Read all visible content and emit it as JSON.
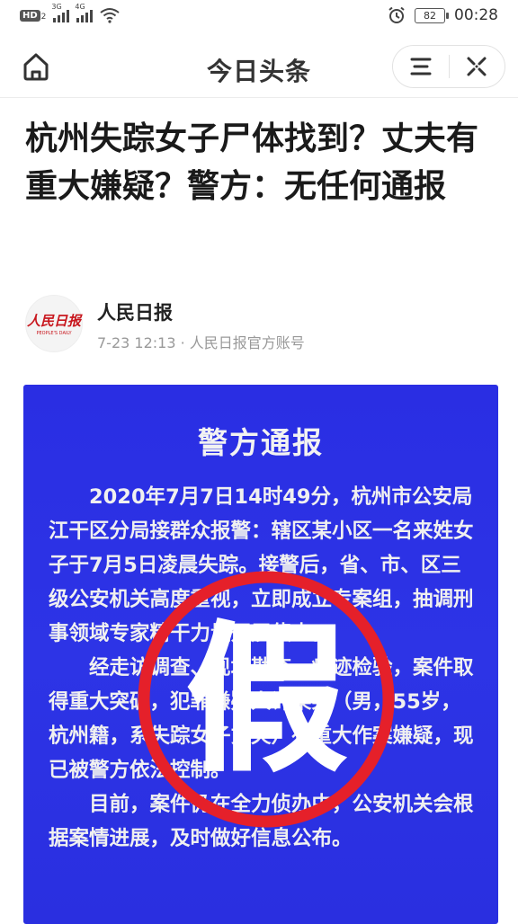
{
  "status_bar": {
    "hd_badge": "HD",
    "sim_num": "2",
    "network_1": "3G",
    "network_2": "4G",
    "battery": "82",
    "time": "00:28"
  },
  "nav": {
    "title": "今日头条"
  },
  "article": {
    "headline": "杭州失踪女子尸体找到？丈夫有重大嫌疑？警方：无任何通报",
    "author": {
      "logo_text": "人民日报",
      "logo_sub": "PEOPLE'S DAILY",
      "name": "人民日报",
      "meta": "7-23 12:13 · 人民日报官方账号"
    },
    "image": {
      "notice_title": "警方通报",
      "paragraphs": [
        "2020年7月7日14时49分，杭州市公安局江干区分局接群众报警：辖区某小区一名来姓女子于7月5日凌晨失踪。接警后，省、市、区三级公安机关高度重视，立即成立专案组，抽调刑事领域专家精干力量开展侦查。",
        "经走访调查、现场勘查、痕迹检验，案件取得重大突破，犯罪嫌疑人许某某（男，55岁，杭州籍，系失踪女子丈夫）有重大作案嫌疑，现已被警方依法控制。",
        "目前，案件仍在全力侦办中，公安机关会根据案情进展，及时做好信息公布。"
      ],
      "stamp_text": "假",
      "stamp_color": "#e5202a"
    }
  }
}
